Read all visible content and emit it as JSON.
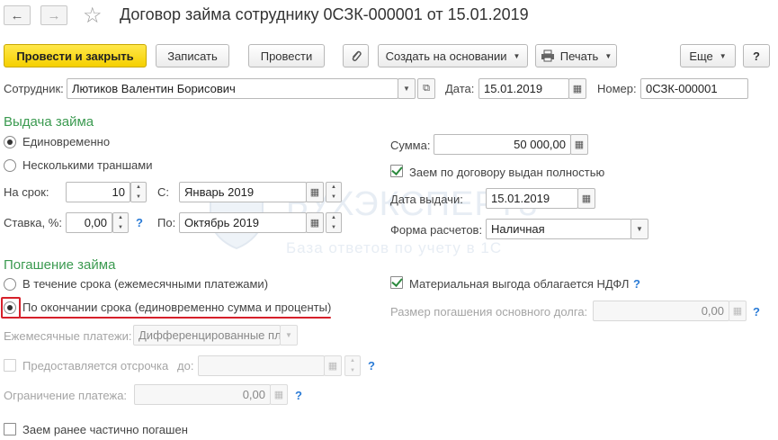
{
  "title": "Договор займа сотруднику 0СЗК-000001 от 15.01.2019",
  "toolbar": {
    "post_close": "Провести и закрыть",
    "save": "Записать",
    "post": "Провести",
    "create_based": "Создать на основании",
    "print": "Печать",
    "more": "Еще",
    "help": "?"
  },
  "header": {
    "employee_label": "Сотрудник:",
    "employee_value": "Лютиков Валентин Борисович",
    "date_label": "Дата:",
    "date_value": "15.01.2019",
    "number_label": "Номер:",
    "number_value": "0СЗК-000001"
  },
  "issue": {
    "title": "Выдача займа",
    "radio_once": "Единовременно",
    "radio_tranches": "Несколькими траншами",
    "term_label": "На срок:",
    "term_value": "10",
    "from_label": "С:",
    "from_value": "Январь 2019",
    "rate_label": "Ставка, %:",
    "rate_value": "0,00",
    "to_label": "По:",
    "to_value": "Октябрь 2019",
    "sum_label": "Сумма:",
    "sum_value": "50 000,00",
    "issued_fully_label": "Заем по договору выдан полностью",
    "issue_date_label": "Дата выдачи:",
    "issue_date_value": "15.01.2019",
    "payment_form_label": "Форма расчетов:",
    "payment_form_value": "Наличная"
  },
  "repay": {
    "title": "Погашение займа",
    "radio_monthly": "В течение срока (ежемесячными платежами)",
    "radio_end": "По окончании срока (единовременно сумма и проценты)",
    "monthly_payments_label": "Ежемесячные платежи:",
    "monthly_payments_value": "Дифференцированные пла",
    "deferral_label": "Предоставляется отсрочка",
    "deferral_to_label": "до:",
    "limit_label": "Ограничение платежа:",
    "limit_value": "0,00",
    "partially_repaid_label": "Заем ранее частично погашен",
    "benefit_ndfl_label": "Материальная выгода облагается НДФЛ",
    "principal_size_label": "Размер погашения основного долга:",
    "principal_size_value": "0,00"
  },
  "watermark": {
    "brand": "БУХЭКСПЕРТ8",
    "tagline": "База ответов по учету в 1С"
  },
  "colors": {
    "section_green": "#3b9a50",
    "primary_yellow": "#f5d000",
    "help_blue": "#2a7bd6",
    "annotation_red": "#d6202a"
  }
}
